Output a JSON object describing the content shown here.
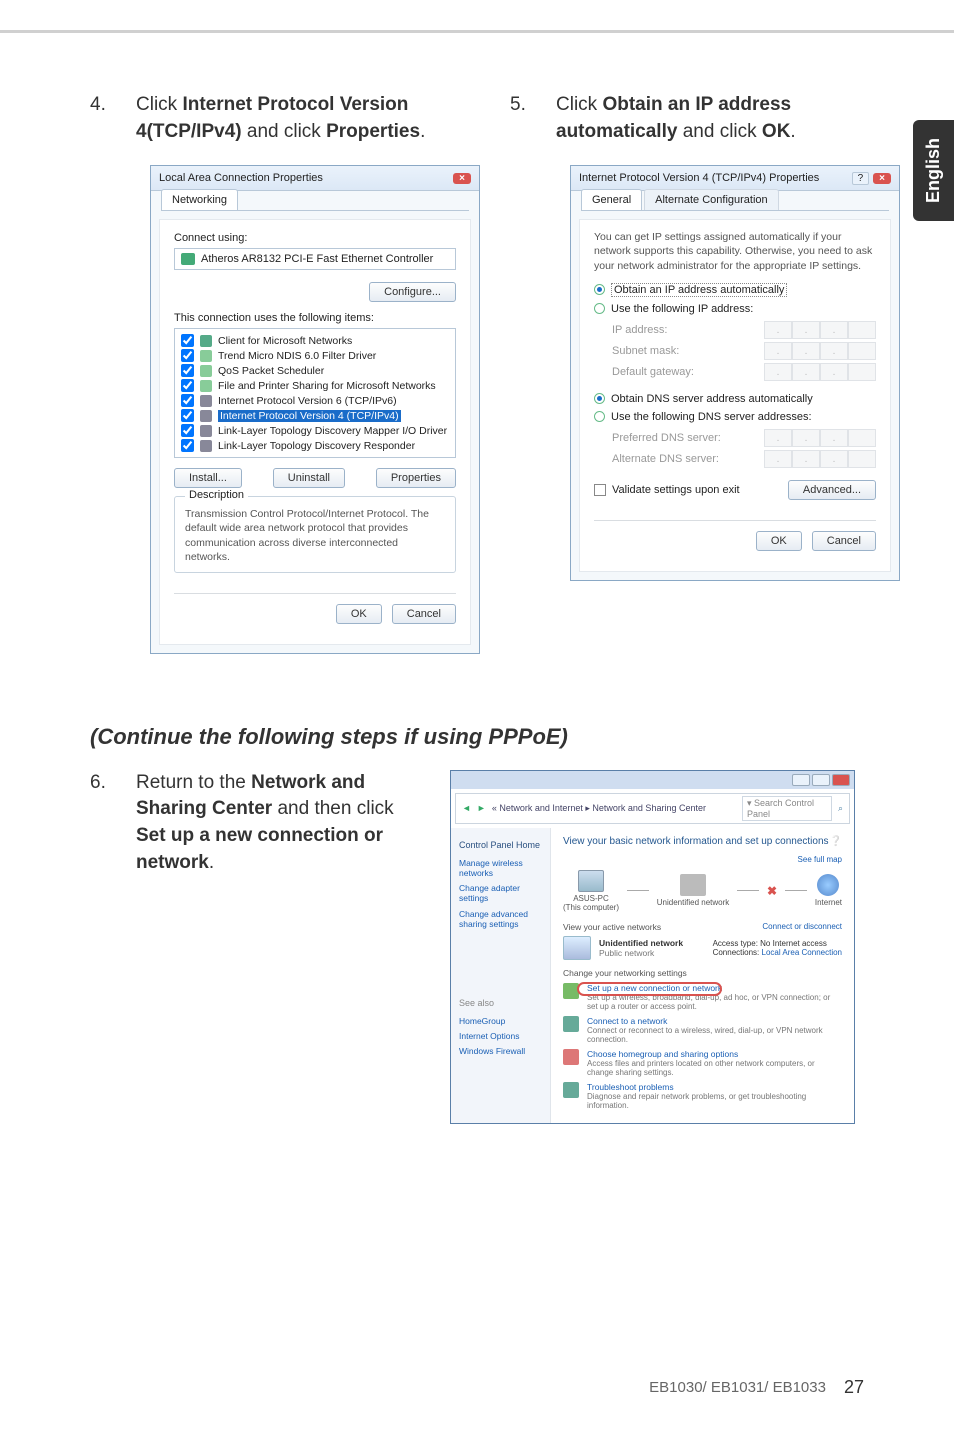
{
  "tab_label": "English",
  "step4": {
    "num": "4.",
    "pre": "Click ",
    "b1": "Internet Protocol Version 4(TCP/IPv4)",
    "mid": " and click ",
    "b2": "Properties",
    "post": "."
  },
  "step5": {
    "num": "5.",
    "pre": "Click ",
    "b1": "Obtain an IP address automatically",
    "mid": " and click ",
    "b2": "OK",
    "post": "."
  },
  "step6": {
    "num": "6.",
    "pre": "Return to the ",
    "b1": "Network and Sharing Center",
    "mid": " and then click ",
    "b2": "Set up a new connection or network",
    "post": "."
  },
  "section_title": "(Continue the following steps if using PPPoE)",
  "lac": {
    "title": "Local Area Connection Properties",
    "tab": "Networking",
    "connect_using": "Connect using:",
    "adapter": "Atheros AR8132 PCI-E Fast Ethernet Controller",
    "configure": "Configure...",
    "uses_items": "This connection uses the following items:",
    "items": [
      "Client for Microsoft Networks",
      "Trend Micro NDIS 6.0 Filter Driver",
      "QoS Packet Scheduler",
      "File and Printer Sharing for Microsoft Networks",
      "Internet Protocol Version 6 (TCP/IPv6)",
      "Internet Protocol Version 4 (TCP/IPv4)",
      "Link-Layer Topology Discovery Mapper I/O Driver",
      "Link-Layer Topology Discovery Responder"
    ],
    "install": "Install...",
    "uninstall": "Uninstall",
    "properties": "Properties",
    "desc_title": "Description",
    "desc": "Transmission Control Protocol/Internet Protocol. The default wide area network protocol that provides communication across diverse interconnected networks.",
    "ok": "OK",
    "cancel": "Cancel"
  },
  "ipv4": {
    "title": "Internet Protocol Version 4 (TCP/IPv4) Properties",
    "tab_general": "General",
    "tab_alt": "Alternate Configuration",
    "blurb": "You can get IP settings assigned automatically if your network supports this capability. Otherwise, you need to ask your network administrator for the appropriate IP settings.",
    "r_auto": "Obtain an IP address automatically",
    "r_use": "Use the following IP address:",
    "ip": "IP address:",
    "mask": "Subnet mask:",
    "gw": "Default gateway:",
    "r_dns_auto": "Obtain DNS server address automatically",
    "r_dns_use": "Use the following DNS server addresses:",
    "pdns": "Preferred DNS server:",
    "adns": "Alternate DNS server:",
    "validate": "Validate settings upon exit",
    "advanced": "Advanced...",
    "ok": "OK",
    "cancel": "Cancel"
  },
  "ncs": {
    "crumb": "« Network and Internet ▸ Network and Sharing Center",
    "search_ph": "Search Control Panel",
    "side_home": "Control Panel Home",
    "side_l1": "Manage wireless networks",
    "side_l2": "Change adapter settings",
    "side_l3": "Change advanced sharing settings",
    "side_see": "See also",
    "side_hg": "HomeGroup",
    "side_io": "Internet Options",
    "side_wf": "Windows Firewall",
    "main_h": "View your basic network information and set up connections",
    "see_full": "See full map",
    "node_pc": "ASUS-PC",
    "node_pc_sub": "(This computer)",
    "node_net": "Unidentified network",
    "node_int": "Internet",
    "active": "View your active networks",
    "conn_disc": "Connect or disconnect",
    "un_net": "Unidentified network",
    "pub": "Public network",
    "access": "Access type:",
    "access_v": "No Internet access",
    "conns": "Connections:",
    "conns_v": "Local Area Connection",
    "change": "Change your networking settings",
    "l1t": "Set up a new connection or network",
    "l1d": "Set up a wireless, broadband, dial-up, ad hoc, or VPN connection; or set up a router or access point.",
    "l2t": "Connect to a network",
    "l2d": "Connect or reconnect to a wireless, wired, dial-up, or VPN network connection.",
    "l3t": "Choose homegroup and sharing options",
    "l3d": "Access files and printers located on other network computers, or change sharing settings.",
    "l4t": "Troubleshoot problems",
    "l4d": "Diagnose and repair network problems, or get troubleshooting information."
  },
  "footer": {
    "model": "EB1030/ EB1031/ EB1033",
    "page": "27"
  }
}
